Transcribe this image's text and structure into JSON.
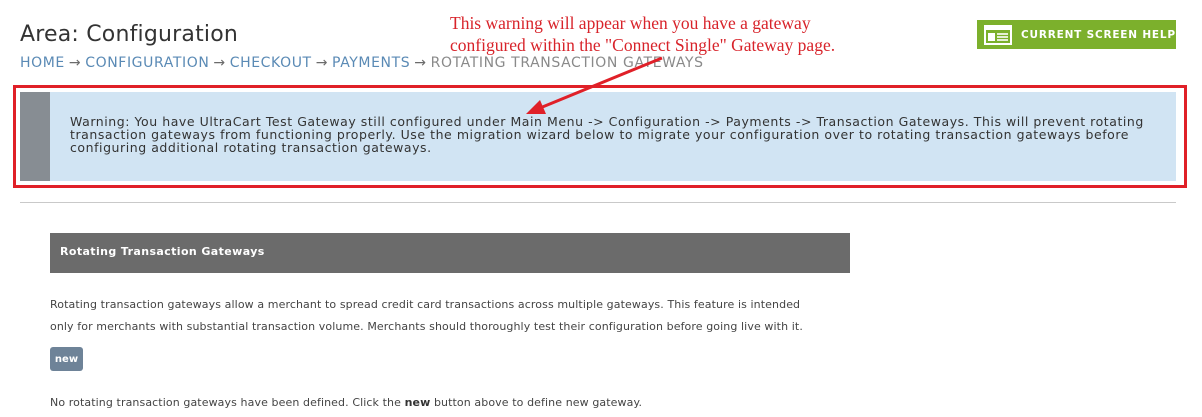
{
  "page": {
    "title": "Area: Configuration"
  },
  "breadcrumb": {
    "items": [
      "HOME",
      "CONFIGURATION",
      "CHECKOUT",
      "PAYMENTS"
    ],
    "current": "ROTATING TRANSACTION GATEWAYS",
    "separator": "→"
  },
  "help_button": {
    "label": "CURRENT SCREEN HELP",
    "icon": "screen-help-icon",
    "color": "#7cb02c"
  },
  "annotation": {
    "line1": "This warning will appear when you have a gateway",
    "line2": "configured within the \"Connect Single\" Gateway page.",
    "color": "#d8232a"
  },
  "warning": {
    "text": "Warning: You have UltraCart Test Gateway still configured under Main Menu -> Configuration -> Payments -> Transaction Gateways. This will prevent rotating transaction gateways from functioning properly. Use the migration wizard below to migrate your configuration over to rotating transaction gateways before configuring additional rotating transaction gateways.",
    "background": "#d1e4f3",
    "highlight_color": "#e02028"
  },
  "section": {
    "title": "Rotating Transaction Gateways",
    "description_line1": "Rotating transaction gateways allow a merchant to spread credit card transactions across multiple gateways. This feature is intended",
    "description_line2": "only for merchants with substantial transaction volume. Merchants should thoroughly test their configuration before going live with it.",
    "new_button_label": "new",
    "empty_pre": "No rotating transaction gateways have been defined. Click the ",
    "empty_bold": "new",
    "empty_post": " button above to define new gateway."
  }
}
